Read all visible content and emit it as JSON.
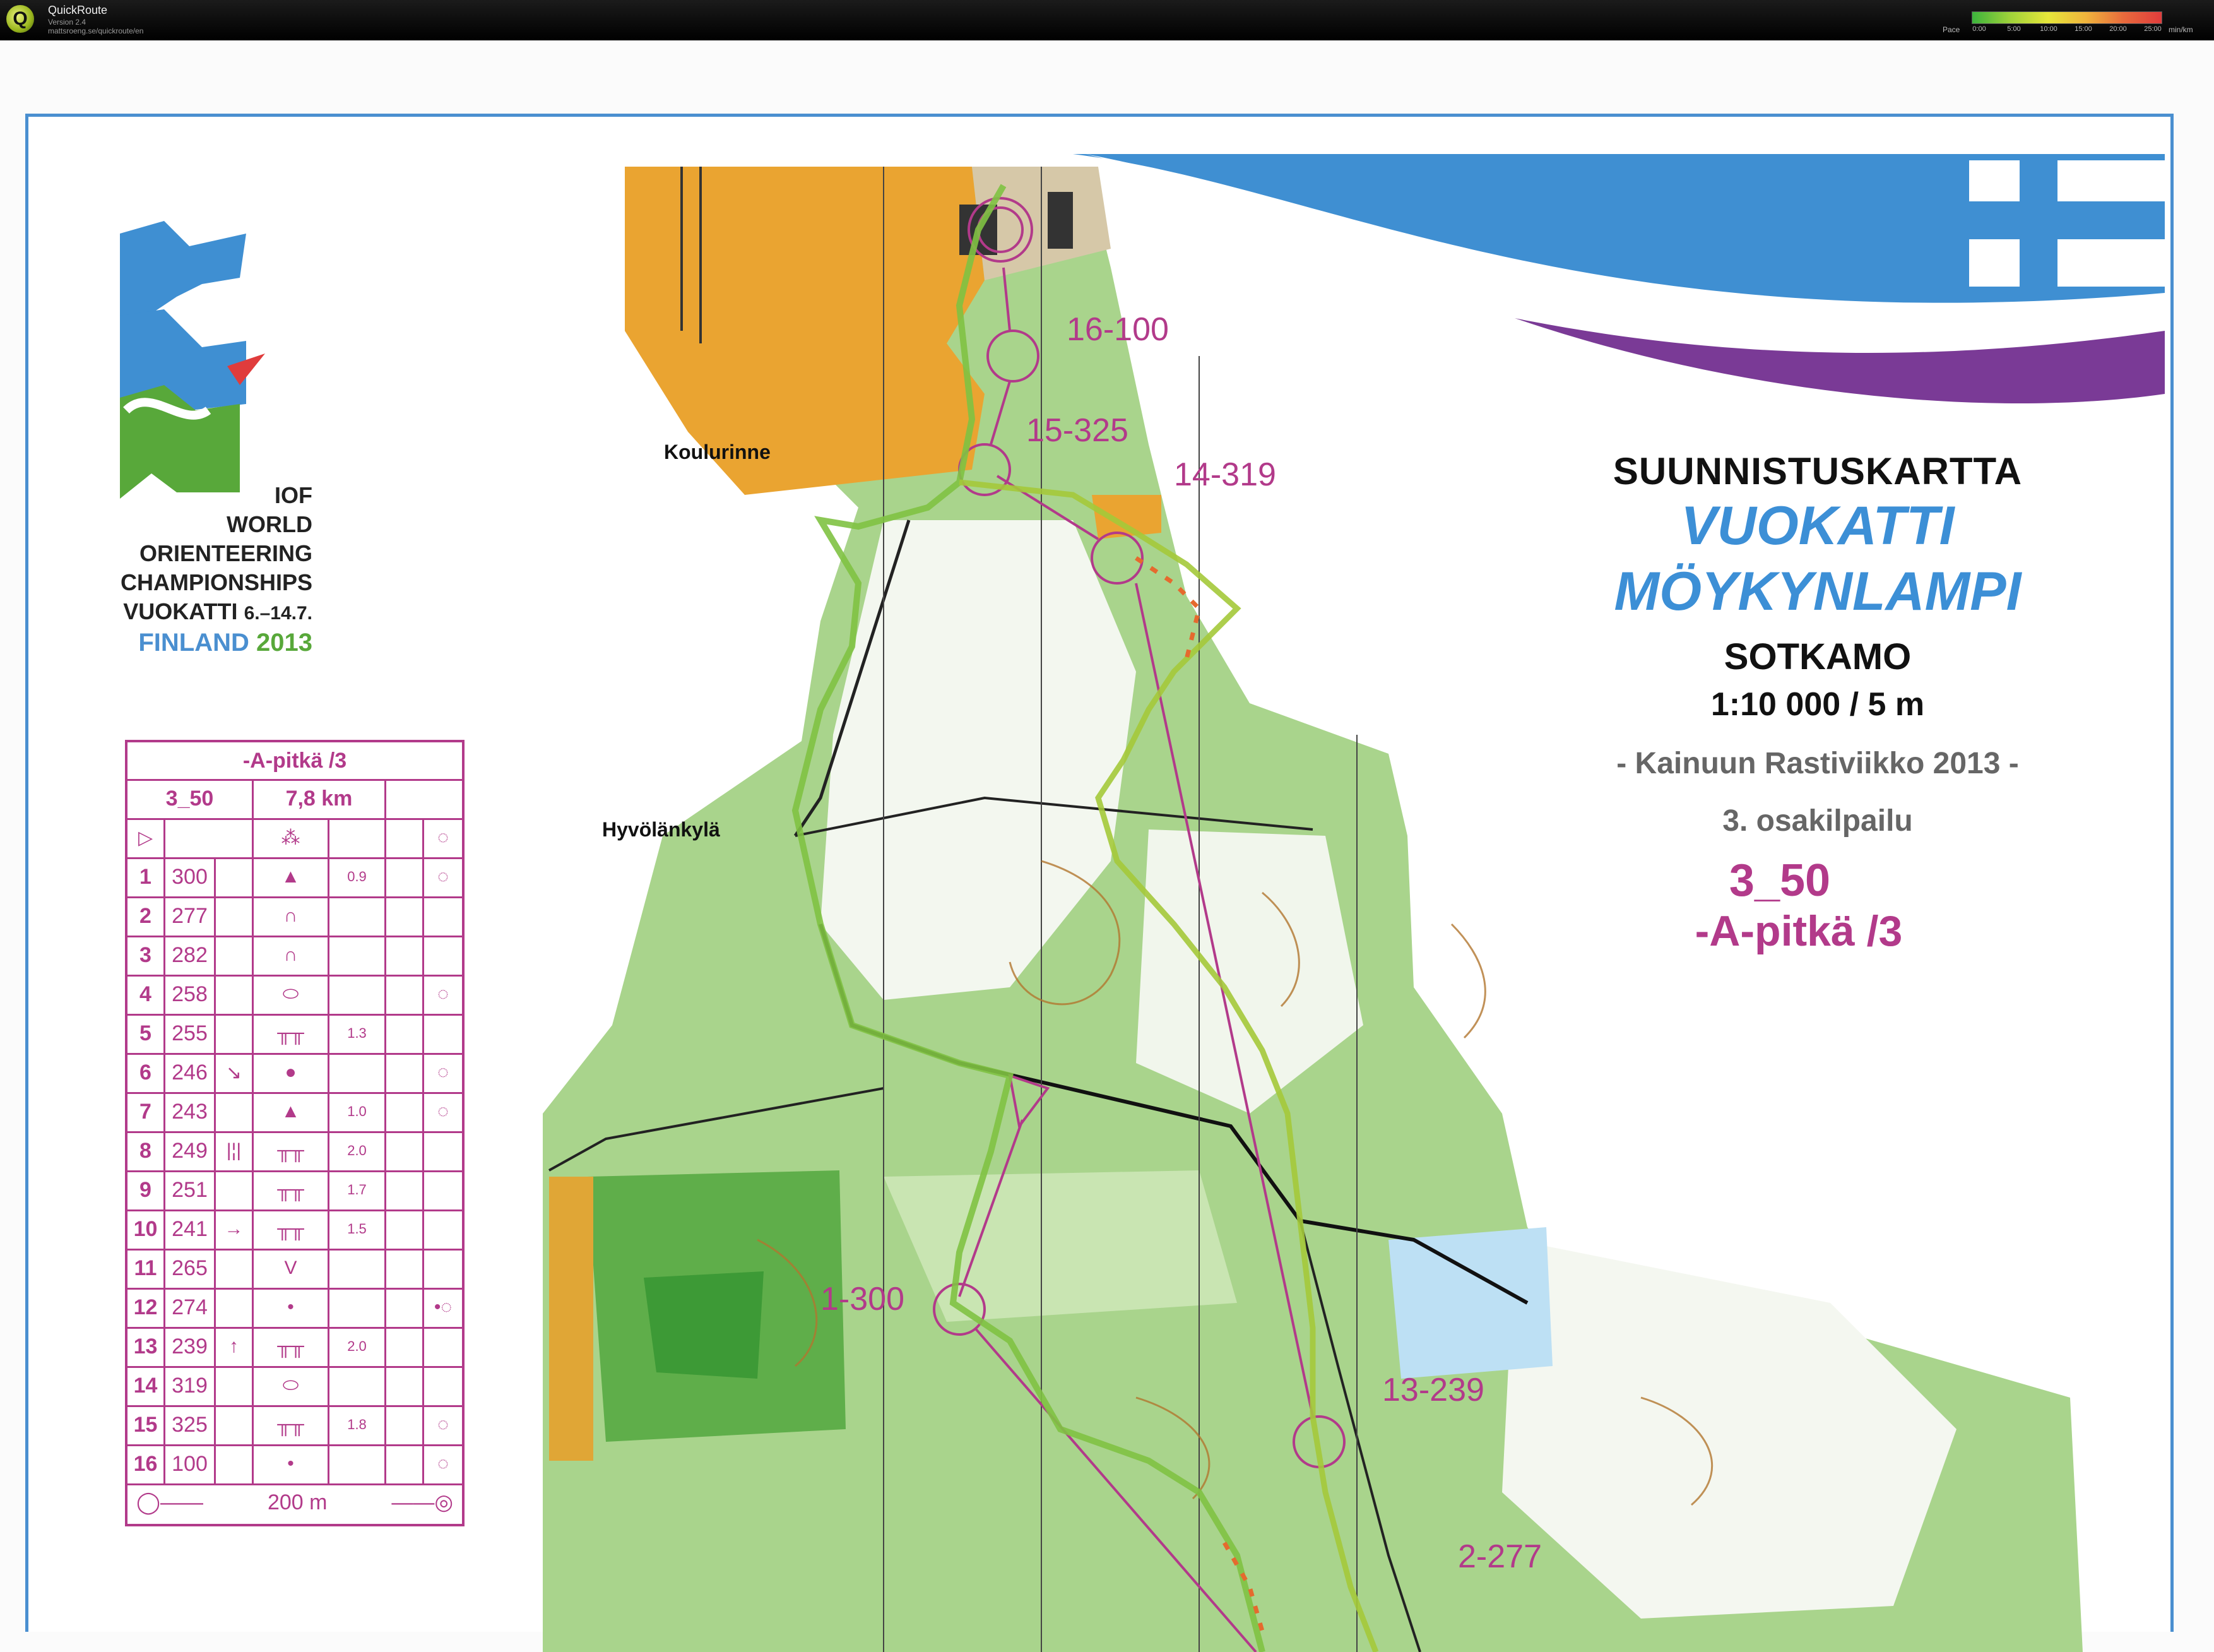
{
  "app": {
    "name": "QuickRoute",
    "version": "Version 2.4",
    "url": "mattsroeng.se/quickroute/en",
    "pace_label": "Pace",
    "pace_ticks": [
      "0:00",
      "5:00",
      "10:00",
      "15:00",
      "20:00",
      "25:00"
    ],
    "pace_unit": "min/km"
  },
  "map": {
    "title": "SUUNNISTUSKARTTA",
    "area_line1": "VUOKATTI",
    "area_line2": "MÖYKYNLAMPI",
    "municipality": "SOTKAMO",
    "scale": "1:10 000 / 5 m",
    "event": "- Kainuun Rastiviikko 2013 -",
    "stage": "3. osakilpailu",
    "course_code": "3_50",
    "course_name": "-A-pitkä /3",
    "places": [
      "Koulurinne",
      "Hyvölänkylä"
    ],
    "control_labels": [
      "16-100",
      "15-325",
      "14-319",
      "1-300",
      "13-239",
      "2-277"
    ],
    "colors": {
      "course": "#b23a8a",
      "frame": "#4a8fd0",
      "open_land": "#eaa431",
      "forest_green": "#8fc46a",
      "route": "#7fc242"
    }
  },
  "logo": {
    "line1": "IOF",
    "line2": "WORLD",
    "line3": "ORIENTEERING",
    "line4": "CHAMPIONSHIPS",
    "line5": "VUOKATTI",
    "dates": "6.–14.7.",
    "country": "FINLAND",
    "year": "2013"
  },
  "descriptions": {
    "title": "-A-pitkä /3",
    "course": "3_50",
    "length": "7,8 km",
    "finish": "200 m",
    "controls": [
      {
        "n": "1",
        "code": "300",
        "dist": "0.9"
      },
      {
        "n": "2",
        "code": "277",
        "dist": ""
      },
      {
        "n": "3",
        "code": "282",
        "dist": ""
      },
      {
        "n": "4",
        "code": "258",
        "dist": ""
      },
      {
        "n": "5",
        "code": "255",
        "dist": "1.3"
      },
      {
        "n": "6",
        "code": "246",
        "dist": ""
      },
      {
        "n": "7",
        "code": "243",
        "dist": "1.0"
      },
      {
        "n": "8",
        "code": "249",
        "dist": "2.0"
      },
      {
        "n": "9",
        "code": "251",
        "dist": "1.7"
      },
      {
        "n": "10",
        "code": "241",
        "dist": "1.5"
      },
      {
        "n": "11",
        "code": "265",
        "dist": ""
      },
      {
        "n": "12",
        "code": "274",
        "dist": ""
      },
      {
        "n": "13",
        "code": "239",
        "dist": "2.0"
      },
      {
        "n": "14",
        "code": "319",
        "dist": ""
      },
      {
        "n": "15",
        "code": "325",
        "dist": "1.8"
      },
      {
        "n": "16",
        "code": "100",
        "dist": ""
      }
    ]
  }
}
